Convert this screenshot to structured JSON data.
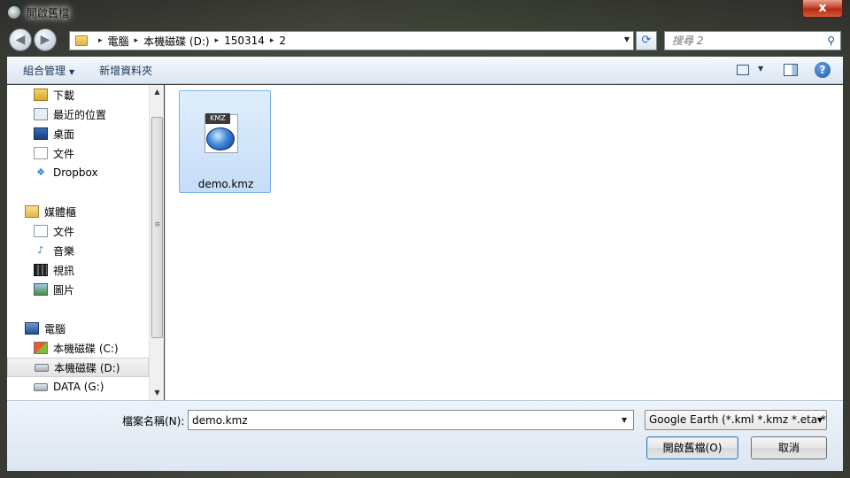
{
  "window": {
    "title": "開啟舊檔",
    "close_label": "x"
  },
  "address": {
    "breadcrumb": [
      "電腦",
      "本機磁碟 (D:)",
      "150314",
      "2"
    ],
    "separator": "▸"
  },
  "search": {
    "placeholder": "搜尋 2"
  },
  "toolbar": {
    "organize_label": "組合管理",
    "new_folder_label": "新增資料夾"
  },
  "nav_pane": {
    "items": [
      {
        "label": "下載",
        "icon": "downloads-icon",
        "kind": "child"
      },
      {
        "label": "最近的位置",
        "icon": "recent-places-icon",
        "kind": "child"
      },
      {
        "label": "桌面",
        "icon": "desktop-icon",
        "kind": "child"
      },
      {
        "label": "文件",
        "icon": "document-icon",
        "kind": "child"
      },
      {
        "label": "Dropbox",
        "icon": "dropbox-icon",
        "kind": "child"
      },
      {
        "label": "媒體櫃",
        "icon": "library-icon",
        "kind": "group"
      },
      {
        "label": "文件",
        "icon": "document-icon",
        "kind": "child"
      },
      {
        "label": "音樂",
        "icon": "music-icon",
        "kind": "child"
      },
      {
        "label": "視訊",
        "icon": "video-icon",
        "kind": "child"
      },
      {
        "label": "圖片",
        "icon": "pictures-icon",
        "kind": "child"
      },
      {
        "label": "電腦",
        "icon": "computer-icon",
        "kind": "group"
      },
      {
        "label": "本機磁碟 (C:)",
        "icon": "drive-c-icon",
        "kind": "child"
      },
      {
        "label": "本機磁碟 (D:)",
        "icon": "drive-icon",
        "kind": "child",
        "selected": true
      },
      {
        "label": "DATA (G:)",
        "icon": "drive-icon",
        "kind": "child"
      }
    ]
  },
  "files": [
    {
      "name": "demo.kmz",
      "badge": "KMZ",
      "icon": "google-earth-icon",
      "selected": true
    }
  ],
  "bottom": {
    "filename_label": "檔案名稱(N):",
    "filename_value": "demo.kmz",
    "filetype_value": "Google Earth (*.kml *.kmz *.eta *",
    "open_label": "開啟舊檔(O)",
    "cancel_label": "取消"
  },
  "colors": {
    "selection": "#c5ddf8",
    "accent": "#1e395b",
    "close": "#c7432c"
  }
}
